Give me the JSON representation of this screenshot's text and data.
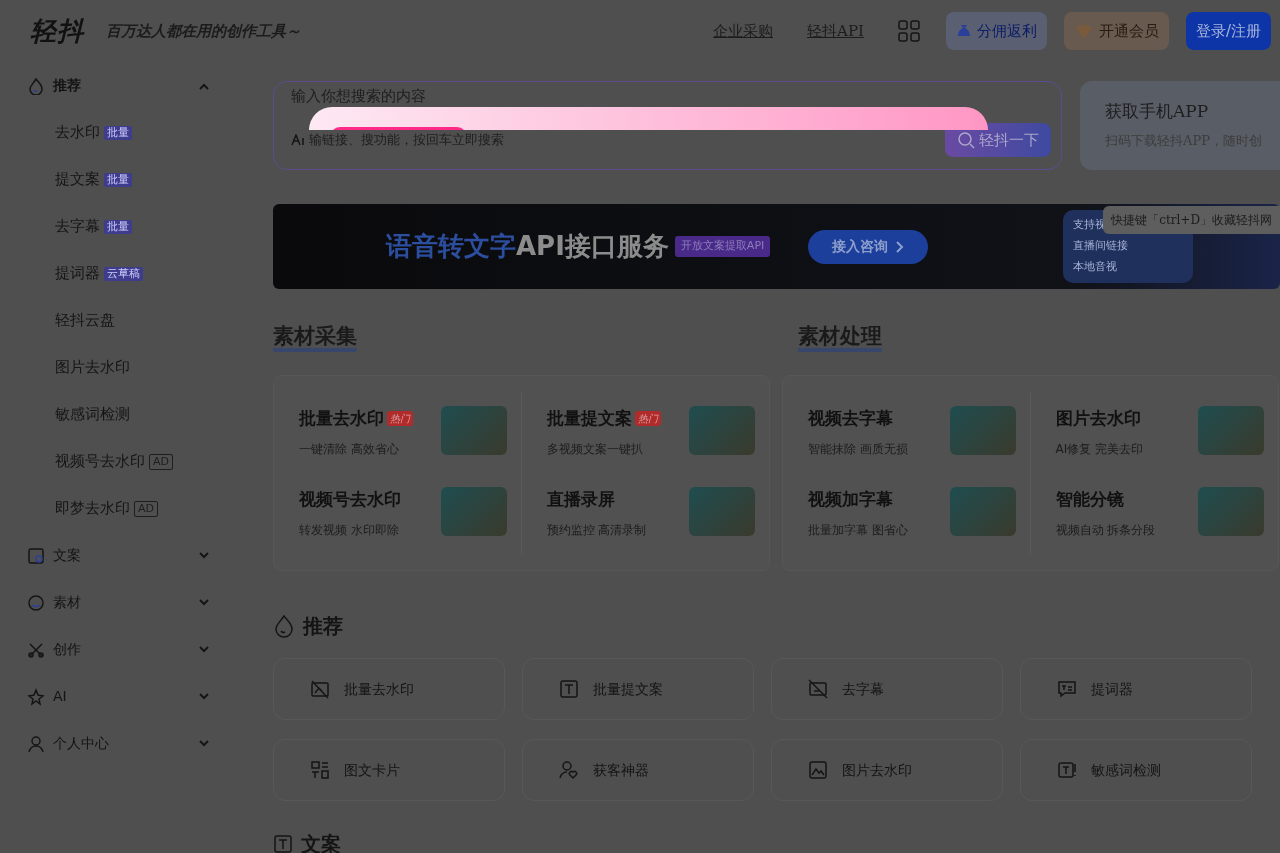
{
  "header": {
    "logo": "轻抖",
    "tagline": "百万达人都在用的创作工具～",
    "nav_links": [
      "企业采购",
      "轻抖API"
    ],
    "buttons": [
      {
        "kind": "rebate",
        "label": "分佣返利"
      },
      {
        "kind": "vip",
        "label": "开通会员"
      },
      {
        "kind": "login",
        "label": "登录/注册"
      }
    ]
  },
  "sidebar": {
    "groups": [
      {
        "label": "推荐",
        "expanded": true,
        "children": [
          {
            "label": "去水印",
            "tag": {
              "kind": "batch",
              "text": "批量"
            }
          },
          {
            "label": "提文案",
            "tag": {
              "kind": "batch",
              "text": "批量"
            }
          },
          {
            "label": "去字幕",
            "tag": {
              "kind": "batch",
              "text": "批量"
            }
          },
          {
            "label": "提词器",
            "tag": {
              "kind": "batch",
              "text": "云草稿"
            }
          },
          {
            "label": "轻抖云盘"
          },
          {
            "label": "图片去水印"
          },
          {
            "label": "敏感词检测"
          },
          {
            "label": "视频号去水印",
            "tag": {
              "kind": "ad",
              "text": "AD"
            }
          },
          {
            "label": "即梦去水印",
            "tag": {
              "kind": "ad",
              "text": "AD"
            }
          }
        ]
      },
      {
        "label": "文案",
        "expanded": false
      },
      {
        "label": "素材",
        "expanded": false
      },
      {
        "label": "创作",
        "expanded": false
      },
      {
        "label": "AI",
        "expanded": false
      },
      {
        "label": "个人中心",
        "expanded": false
      }
    ]
  },
  "search": {
    "placeholder": "输入你想搜索的内容",
    "hint": "输链接、搜功能，按回车立即搜索",
    "button": "轻抖一下"
  },
  "app_card": {
    "title": "获取手机APP",
    "subtitle": "扫码下载轻抖APP，随时创"
  },
  "tooltip": "快捷键「ctrl+D」收藏轻抖网",
  "banner": {
    "highlight": "语音转文字",
    "title": "API接口服务",
    "tag": "开放文案提取API",
    "button": "接入咨询",
    "side_texts": [
      "支持视",
      "直播间链接",
      "本地音视"
    ]
  },
  "sections": [
    {
      "title": "素材采集",
      "tiles": [
        {
          "title": "批量去水印",
          "badge": "热门",
          "subtitle": "一键清除 高效省心"
        },
        {
          "title": "批量提文案",
          "badge": "热门",
          "subtitle": "多视频文案一键扒"
        },
        {
          "title": "视频号去水印",
          "subtitle": "转发视频 水印即除"
        },
        {
          "title": "直播录屏",
          "subtitle": "预约监控 高清录制"
        }
      ]
    },
    {
      "title": "素材处理",
      "tiles": [
        {
          "title": "视频去字幕",
          "subtitle": "智能抹除 画质无损"
        },
        {
          "title": "图片去水印",
          "subtitle": "AI修复 完美去印"
        },
        {
          "title": "视频加字幕",
          "subtitle": "批量加字幕 图省心"
        },
        {
          "title": "智能分镜",
          "subtitle": "视频自动 拆条分段"
        }
      ]
    }
  ],
  "recommend": {
    "title": "推荐",
    "tools": [
      "批量去水印",
      "批量提文案",
      "去字幕",
      "提词器",
      "图文卡片",
      "获客神器",
      "图片去水印",
      "敏感词检测"
    ]
  },
  "next_section": {
    "title": "文案"
  }
}
